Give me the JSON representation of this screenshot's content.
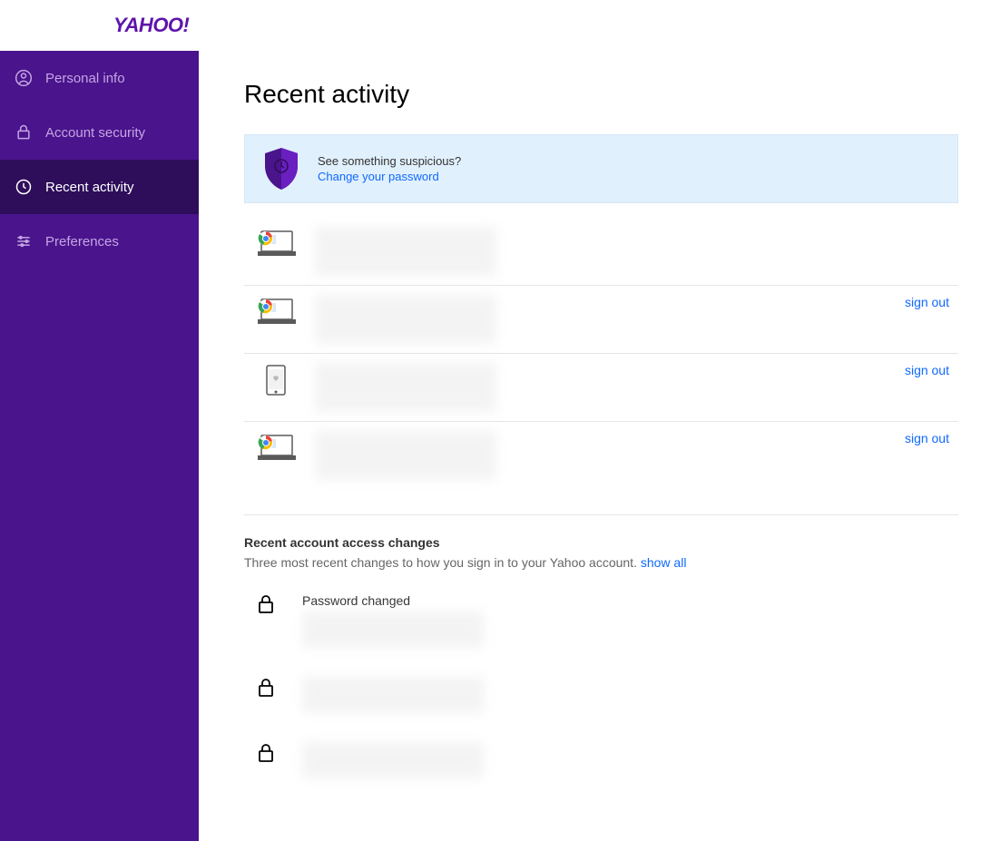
{
  "header": {
    "logo_text": "YAHOO!"
  },
  "sidebar": {
    "items": [
      {
        "label": "Personal info",
        "icon": "person-icon",
        "active": false
      },
      {
        "label": "Account security",
        "icon": "lock-icon",
        "active": false
      },
      {
        "label": "Recent activity",
        "icon": "clock-icon",
        "active": true
      },
      {
        "label": "Preferences",
        "icon": "sliders-icon",
        "active": false
      }
    ]
  },
  "main": {
    "title": "Recent activity",
    "alert": {
      "text": "See something suspicious?",
      "link_text": "Change your password"
    },
    "sessions": [
      {
        "device_icon": "chrome-laptop",
        "signout": ""
      },
      {
        "device_icon": "chrome-laptop",
        "signout": "sign out"
      },
      {
        "device_icon": "iphone",
        "signout": "sign out"
      },
      {
        "device_icon": "chrome-laptop",
        "signout": "sign out"
      }
    ],
    "changes_section": {
      "title": "Recent account access changes",
      "subtitle": "Three most recent changes to how you sign in to your Yahoo account.",
      "show_all": "show all",
      "items": [
        {
          "label": "Password changed"
        },
        {
          "label": ""
        },
        {
          "label": ""
        }
      ]
    }
  }
}
